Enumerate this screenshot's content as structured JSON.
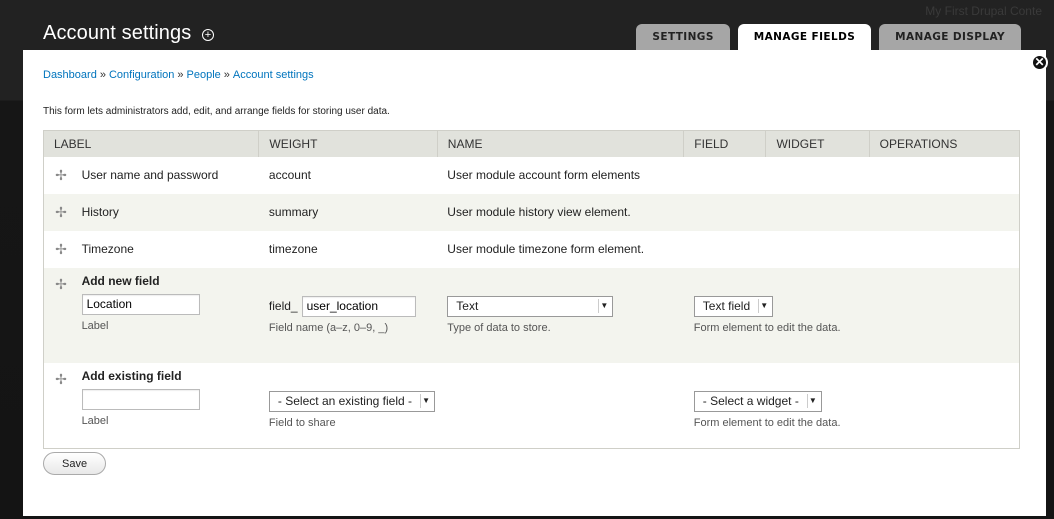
{
  "site": {
    "name": "My First Drupal Conte"
  },
  "page": {
    "title": "Account settings",
    "add_shortcut": "+"
  },
  "tabs": [
    {
      "label": "SETTINGS",
      "active": false
    },
    {
      "label": "MANAGE FIELDS",
      "active": true
    },
    {
      "label": "MANAGE DISPLAY",
      "active": false
    }
  ],
  "breadcrumb": {
    "items": [
      "Dashboard",
      "Configuration",
      "People",
      "Account settings"
    ],
    "separator": "»"
  },
  "description": "This form lets administrators add, edit, and arrange fields for storing user data.",
  "table": {
    "headers": [
      "LABEL",
      "WEIGHT",
      "NAME",
      "FIELD",
      "WIDGET",
      "OPERATIONS"
    ],
    "rows": [
      {
        "label": "User name and password",
        "weight": "account",
        "name": "User module account form elements"
      },
      {
        "label": "History",
        "weight": "summary",
        "name": "User module history view element."
      },
      {
        "label": "Timezone",
        "weight": "timezone",
        "name": "User module timezone form element."
      }
    ],
    "add_new": {
      "title": "Add new field",
      "label_value": "Location",
      "label_help": "Label",
      "field_prefix": "field_",
      "field_name_value": "user_location",
      "field_name_help": "Field name (a–z, 0–9, _)",
      "type_value": "Text",
      "type_help": "Type of data to store.",
      "widget_value": "Text field",
      "widget_help": "Form element to edit the data."
    },
    "add_existing": {
      "title": "Add existing field",
      "label_value": "",
      "label_help": "Label",
      "field_select": "- Select an existing field -",
      "field_help": "Field to share",
      "widget_select": "- Select a widget -",
      "widget_help": "Form element to edit the data."
    }
  },
  "save_label": "Save",
  "close_icon": "close-icon",
  "drag_icon": "drag-handle-icon"
}
